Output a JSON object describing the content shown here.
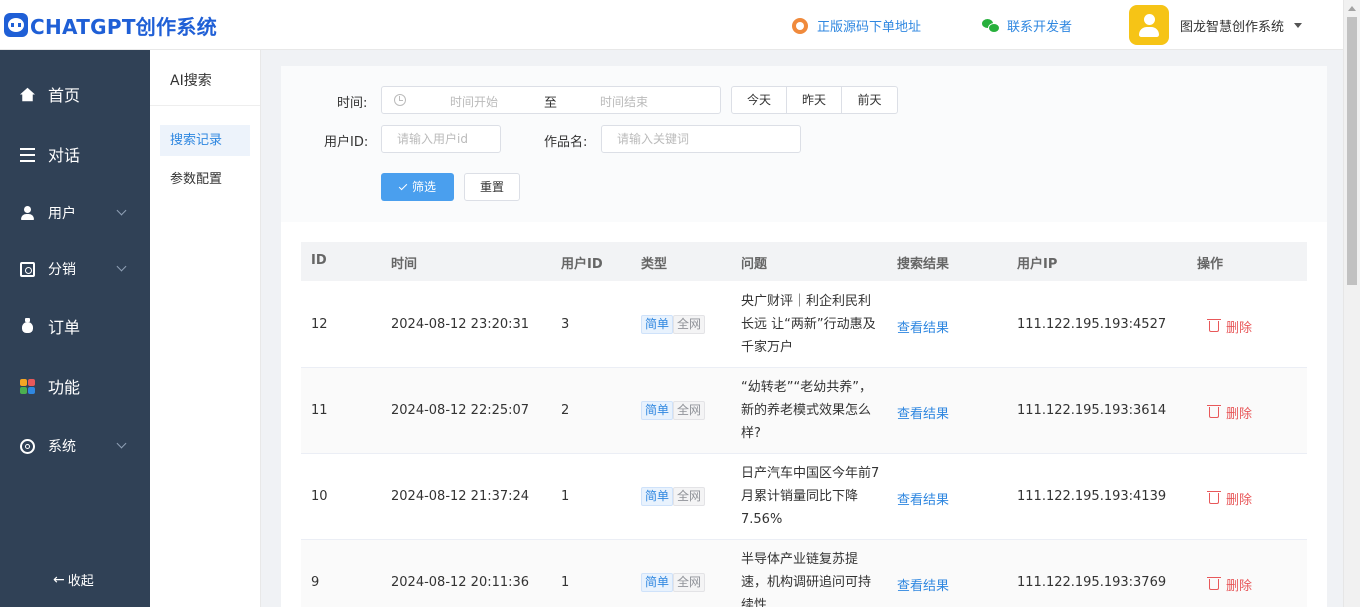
{
  "app": {
    "logo_text": "CHATGPT创作系统",
    "source_link": "正版源码下单地址",
    "contact_link": "联系开发者",
    "user_name": "图龙智慧创作系统"
  },
  "sidebar": {
    "items": [
      {
        "label": "首页",
        "icon": "home-icon"
      },
      {
        "label": "对话",
        "icon": "list-icon"
      },
      {
        "label": "用户",
        "icon": "user-icon"
      },
      {
        "label": "分销",
        "icon": "distribution-icon"
      },
      {
        "label": "订单",
        "icon": "order-bag-icon"
      },
      {
        "label": "功能",
        "icon": "grid-icon"
      },
      {
        "label": "系统",
        "icon": "gear-icon"
      }
    ],
    "collapse_label": "收起"
  },
  "subnav": {
    "title": "AI搜索",
    "items": [
      {
        "label": "搜索记录",
        "active": true
      },
      {
        "label": "参数配置",
        "active": false
      }
    ]
  },
  "filter": {
    "time_label": "时间:",
    "start_placeholder": "时间开始",
    "range_sep": "至",
    "end_placeholder": "时间结束",
    "quick": [
      "今天",
      "昨天",
      "前天"
    ],
    "user_id_label": "用户ID:",
    "user_id_placeholder": "请输入用户id",
    "work_label": "作品名:",
    "work_placeholder": "请输入关键词",
    "filter_button": "筛选",
    "reset_button": "重置"
  },
  "table": {
    "columns": [
      "ID",
      "时间",
      "用户ID",
      "类型",
      "问题",
      "搜索结果",
      "用户IP",
      "操作"
    ],
    "rows": [
      {
        "id": "12",
        "time": "2024-08-12 23:20:31",
        "user_id": "3",
        "tag1": "简单",
        "tag2": "全网",
        "question": "央广财评｜利企利民利长远 让“两新”行动惠及千家万户",
        "result": "查看结果",
        "ip": "111.122.195.193:4527",
        "action": "删除"
      },
      {
        "id": "11",
        "time": "2024-08-12 22:25:07",
        "user_id": "2",
        "tag1": "简单",
        "tag2": "全网",
        "question": "“幼转老”“老幼共养”，新的养老模式效果怎么样?",
        "result": "查看结果",
        "ip": "111.122.195.193:3614",
        "action": "删除"
      },
      {
        "id": "10",
        "time": "2024-08-12 21:37:24",
        "user_id": "1",
        "tag1": "简单",
        "tag2": "全网",
        "question": "日产汽车中国区今年前7月累计销量同比下降7.56%",
        "result": "查看结果",
        "ip": "111.122.195.193:4139",
        "action": "删除"
      },
      {
        "id": "9",
        "time": "2024-08-12 20:11:36",
        "user_id": "1",
        "tag1": "简单",
        "tag2": "全网",
        "question": "半导体产业链复苏提速，机构调研追问可持续性",
        "result": "查看结果",
        "ip": "111.122.195.193:3769",
        "action": "删除"
      }
    ]
  },
  "colors": {
    "sidebar_bg": "#304156",
    "accent": "#2f87e0",
    "primary_button": "#4a9fee",
    "danger": "#e8585a",
    "logo": "#1f5fd6"
  }
}
